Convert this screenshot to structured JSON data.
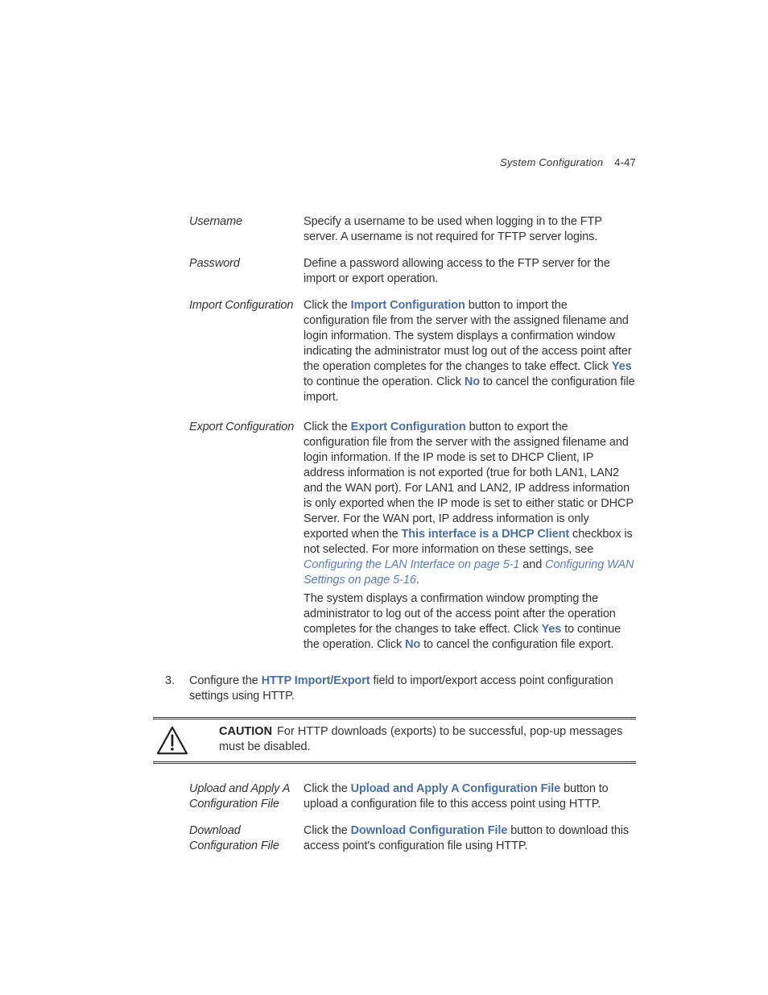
{
  "header": {
    "section_title": "System Configuration",
    "page_ref": "4-47"
  },
  "defs1": {
    "username": {
      "term": "Username",
      "desc": "Specify a username to be used when logging in to the FTP server. A username is not required for TFTP server logins."
    },
    "password": {
      "term": "Password",
      "desc": "Define a password allowing access to the FTP server for the import or export operation."
    },
    "import_cfg": {
      "term": "Import Configuration",
      "pre": "Click the ",
      "btn": "Import Configuration",
      "mid1": " button to import the configuration file from the server with the assigned filename and login information. The system displays a confirmation window indicating the administrator must log out of the access point after the operation completes for the changes to take effect. Click ",
      "yes": "Yes",
      "mid2": " to continue the operation. Click ",
      "no": "No",
      "post": " to cancel the configuration file import."
    },
    "export_cfg": {
      "term": "Export Configuration",
      "p1_pre": "Click the ",
      "p1_btn": "Export Configuration",
      "p1_mid": " button to export the configuration file from the server with the assigned filename and login information. If the IP mode is set to DHCP Client, IP address information is not exported (true for both LAN1, LAN2 and the WAN port). For LAN1 and LAN2, IP address information is only exported when the IP mode is set to either static or DHCP Server. For the WAN port, IP address information is only exported when the ",
      "p1_cb": "This interface is a DHCP Client",
      "p1_mid2": " checkbox is not selected. For more information on these settings, see ",
      "p1_link1": "Configuring the LAN Interface on page 5-1",
      "p1_and": " and ",
      "p1_link2": "Configuring WAN Settings on page 5-16",
      "p1_end": ".",
      "p2_pre": "The system displays a confirmation window prompting the administrator to log out of the access point after the operation completes for the changes to take effect. Click ",
      "p2_yes": "Yes",
      "p2_mid": " to continue the operation. Click ",
      "p2_no": "No",
      "p2_post": " to cancel the configuration file export."
    }
  },
  "step3": {
    "num": "3.",
    "pre": "Configure the ",
    "bold": "HTTP Import/Export",
    "post": " field to import/export access point configuration settings using HTTP."
  },
  "caution": {
    "label": "CAUTION",
    "text": "For HTTP downloads (exports) to be successful, pop-up messages must be disabled."
  },
  "defs2": {
    "upload": {
      "term": "Upload and Apply A Configuration File",
      "pre": "Click the ",
      "btn": "Upload and Apply A Configuration File",
      "post": " button to upload a configuration file to this access point using HTTP."
    },
    "download": {
      "term": "Download Configuration File",
      "pre": "Click the ",
      "btn": "Download Configuration File",
      "post": " button to download this access point's configuration file using HTTP."
    }
  }
}
